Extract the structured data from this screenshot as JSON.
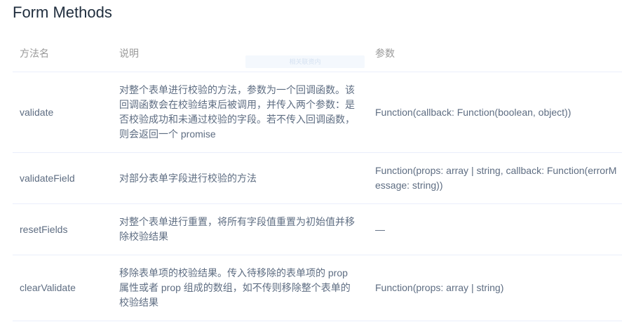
{
  "page": {
    "title": "Form Methods"
  },
  "table": {
    "headers": {
      "name": "方法名",
      "description": "说明",
      "params": "参数"
    },
    "rows": [
      {
        "name": "validate",
        "description": "对整个表单进行校验的方法，参数为一个回调函数。该回调函数会在校验结束后被调用，并传入两个参数：是否校验成功和未通过校验的字段。若不传入回调函数，则会返回一个 promise",
        "params": "Function(callback: Function(boolean, object))"
      },
      {
        "name": "validateField",
        "description": "对部分表单字段进行校验的方法",
        "params": "Function(props: array | string, callback: Function(errorMessage: string))"
      },
      {
        "name": "resetFields",
        "description": "对整个表单进行重置，将所有字段值重置为初始值并移除校验结果",
        "params": "—"
      },
      {
        "name": "clearValidate",
        "description": "移除表单项的校验结果。传入待移除的表单项的 prop 属性或者 prop 组成的数组，如不传则移除整个表单的校验结果",
        "params": "Function(props: array | string)"
      }
    ]
  },
  "overlay": {
    "text": "相关联资内"
  },
  "colors": {
    "title": "#1f2d3d",
    "header_text": "#999999",
    "body_text": "#5e6d82",
    "border": "#eaeefb"
  }
}
